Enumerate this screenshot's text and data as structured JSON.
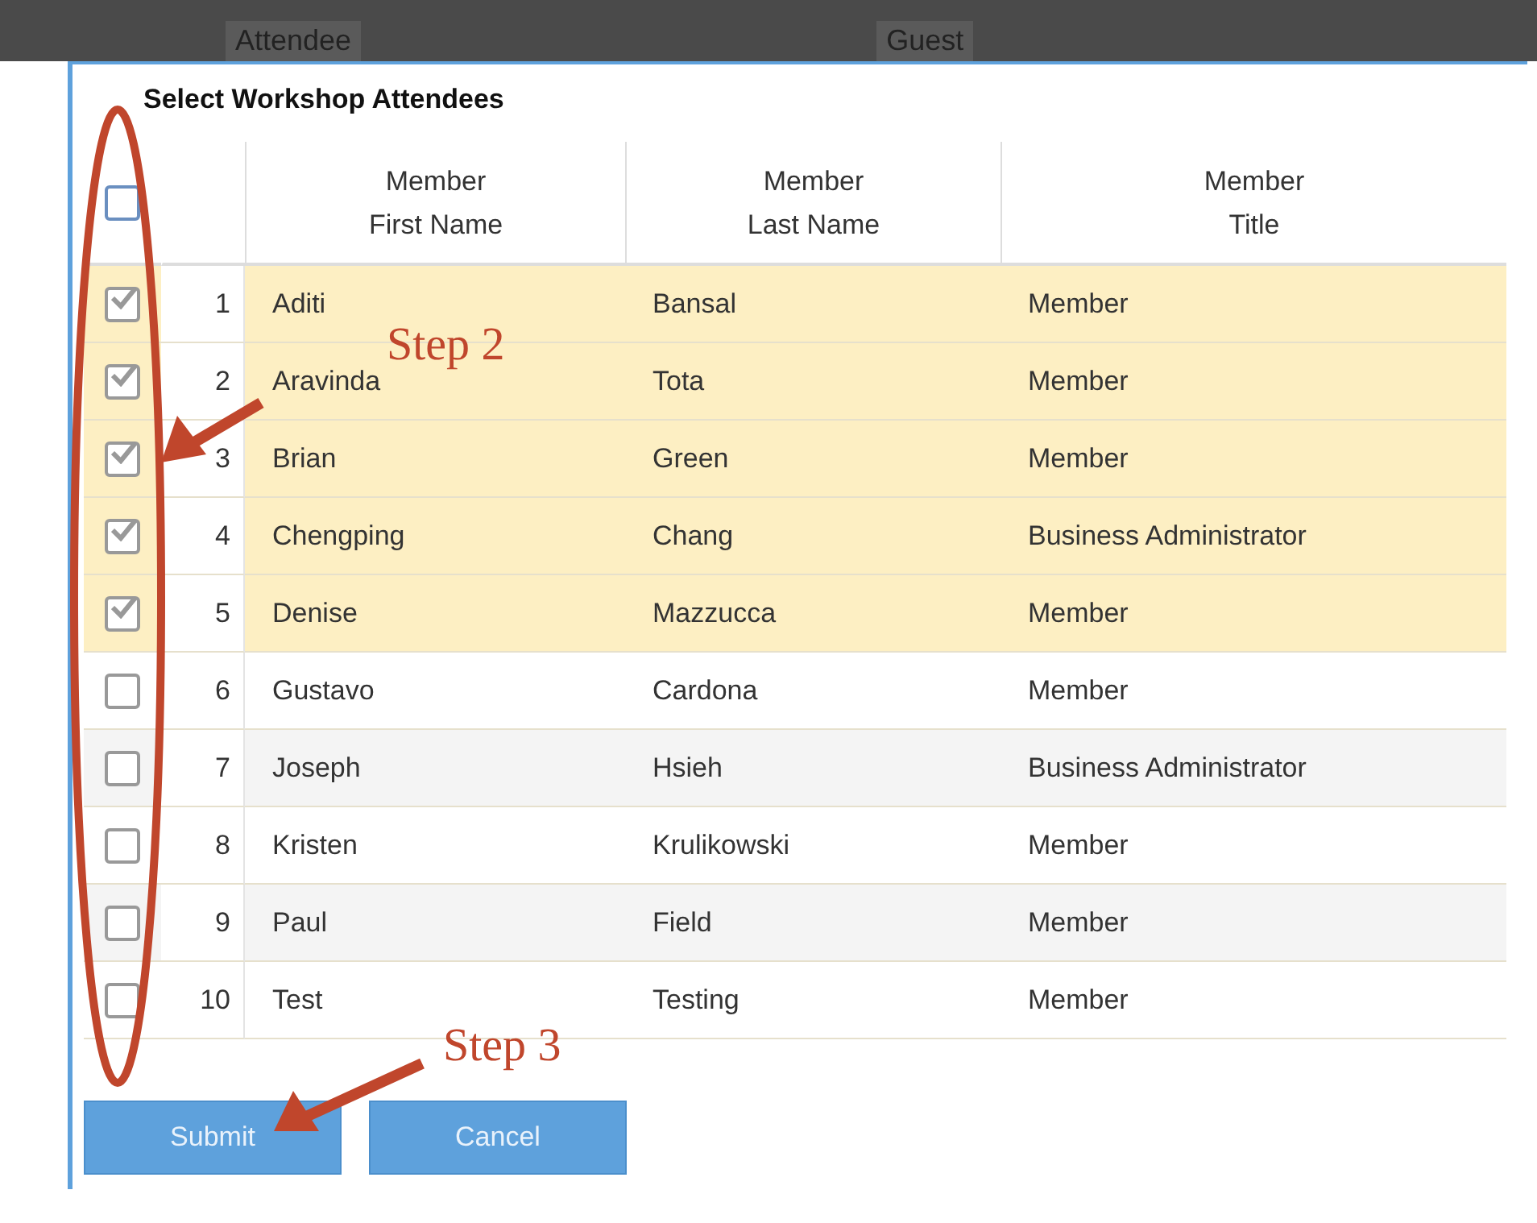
{
  "background_header": [
    "Attendee",
    "Guest"
  ],
  "dialog": {
    "title": "Select Workshop Attendees"
  },
  "table": {
    "select_all_checked": false,
    "columns": [
      "Member\nFirst Name",
      "Member\nLast Name",
      "Member\nTitle"
    ],
    "rows": [
      {
        "number": "1",
        "first": "Aditi",
        "last": "Bansal",
        "title": "Member",
        "checked": true
      },
      {
        "number": "2",
        "first": "Aravinda",
        "last": "Tota",
        "title": "Member",
        "checked": true
      },
      {
        "number": "3",
        "first": "Brian",
        "last": "Green",
        "title": "Member",
        "checked": true
      },
      {
        "number": "4",
        "first": "Chengping",
        "last": "Chang",
        "title": "Business Administrator",
        "checked": true
      },
      {
        "number": "5",
        "first": "Denise",
        "last": "Mazzucca",
        "title": "Member",
        "checked": true
      },
      {
        "number": "6",
        "first": "Gustavo",
        "last": "Cardona",
        "title": "Member",
        "checked": false
      },
      {
        "number": "7",
        "first": "Joseph",
        "last": "Hsieh",
        "title": "Business Administrator",
        "checked": false
      },
      {
        "number": "8",
        "first": "Kristen",
        "last": "Krulikowski",
        "title": "Member",
        "checked": false
      },
      {
        "number": "9",
        "first": "Paul",
        "last": "Field",
        "title": "Member",
        "checked": false
      },
      {
        "number": "10",
        "first": "Test",
        "last": "Testing",
        "title": "Member",
        "checked": false
      }
    ]
  },
  "buttons": [
    "Submit",
    "Cancel"
  ],
  "annotations": [
    "Step 2",
    "Step 3"
  ]
}
